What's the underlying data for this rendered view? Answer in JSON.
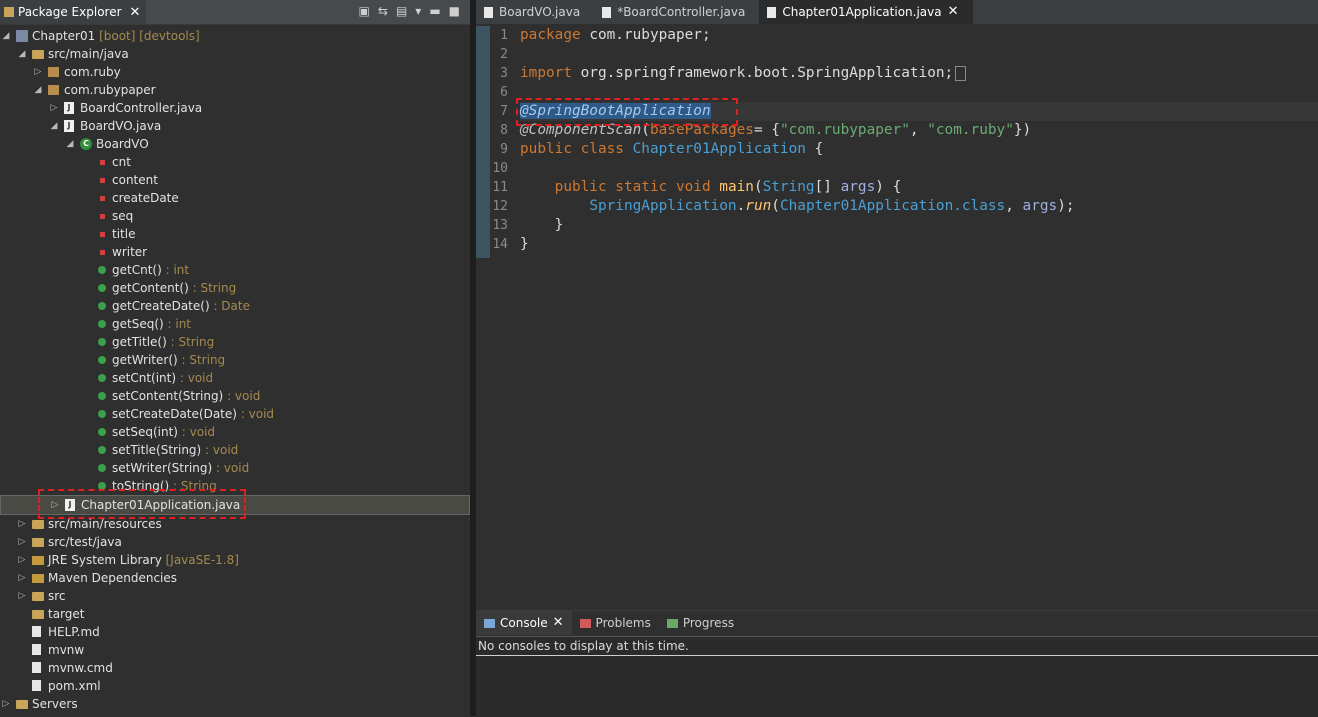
{
  "package_explorer": {
    "title": "Package Explorer",
    "tree": [
      {
        "label": "Chapter01",
        "dec": " [boot] [devtools]",
        "icon": "project-icon",
        "depth": 0,
        "expanded": true
      },
      {
        "label": "src/main/java",
        "dec": "",
        "icon": "folder-icon",
        "depth": 1,
        "expanded": true
      },
      {
        "label": "com.ruby",
        "dec": "",
        "icon": "package-icon",
        "depth": 2,
        "expanded": false
      },
      {
        "label": "com.rubypaper",
        "dec": "",
        "icon": "package-icon",
        "depth": 2,
        "expanded": true
      },
      {
        "label": "BoardController.java",
        "dec": "",
        "icon": "java-file-icon",
        "depth": 3,
        "expanded": false
      },
      {
        "label": "BoardVO.java",
        "dec": "",
        "icon": "java-file-icon",
        "depth": 3,
        "expanded": true
      },
      {
        "label": "BoardVO",
        "dec": "",
        "icon": "class-icon",
        "depth": 4,
        "expanded": true
      },
      {
        "label": "cnt",
        "dec": "",
        "icon": "field-icon",
        "depth": 5
      },
      {
        "label": "content",
        "dec": "",
        "icon": "field-icon",
        "depth": 5
      },
      {
        "label": "createDate",
        "dec": "",
        "icon": "field-icon",
        "depth": 5
      },
      {
        "label": "seq",
        "dec": "",
        "icon": "field-icon",
        "depth": 5
      },
      {
        "label": "title",
        "dec": "",
        "icon": "field-icon",
        "depth": 5
      },
      {
        "label": "writer",
        "dec": "",
        "icon": "field-icon",
        "depth": 5
      },
      {
        "label": "getCnt()",
        "dec": " : int",
        "icon": "method-icon",
        "depth": 5
      },
      {
        "label": "getContent()",
        "dec": " : String",
        "icon": "method-icon",
        "depth": 5
      },
      {
        "label": "getCreateDate()",
        "dec": " : Date",
        "icon": "method-icon",
        "depth": 5
      },
      {
        "label": "getSeq()",
        "dec": " : int",
        "icon": "method-icon",
        "depth": 5
      },
      {
        "label": "getTitle()",
        "dec": " : String",
        "icon": "method-icon",
        "depth": 5
      },
      {
        "label": "getWriter()",
        "dec": " : String",
        "icon": "method-icon",
        "depth": 5
      },
      {
        "label": "setCnt(int)",
        "dec": " : void",
        "icon": "method-icon",
        "depth": 5
      },
      {
        "label": "setContent(String)",
        "dec": " : void",
        "icon": "method-icon",
        "depth": 5
      },
      {
        "label": "setCreateDate(Date)",
        "dec": " : void",
        "icon": "method-icon",
        "depth": 5
      },
      {
        "label": "setSeq(int)",
        "dec": " : void",
        "icon": "method-icon",
        "depth": 5
      },
      {
        "label": "setTitle(String)",
        "dec": " : void",
        "icon": "method-icon",
        "depth": 5
      },
      {
        "label": "setWriter(String)",
        "dec": " : void",
        "icon": "method-icon",
        "depth": 5
      },
      {
        "label": "toString()",
        "dec": " : String",
        "icon": "method-icon",
        "depth": 5
      },
      {
        "label": "Chapter01Application.java",
        "dec": "",
        "icon": "java-file-icon",
        "depth": 3,
        "expanded": false,
        "selected": true
      },
      {
        "label": "src/main/resources",
        "dec": "",
        "icon": "folder-icon",
        "depth": 1,
        "expanded": false
      },
      {
        "label": "src/test/java",
        "dec": "",
        "icon": "folder-icon",
        "depth": 1,
        "expanded": false
      },
      {
        "label": "JRE System Library",
        "dec": " [JavaSE-1.8]",
        "icon": "library-icon",
        "depth": 1,
        "expanded": false
      },
      {
        "label": "Maven Dependencies",
        "dec": "",
        "icon": "library-icon",
        "depth": 1,
        "expanded": false
      },
      {
        "label": "src",
        "dec": "",
        "icon": "folder-icon",
        "depth": 1,
        "expanded": false
      },
      {
        "label": "target",
        "dec": "",
        "icon": "folder-icon",
        "depth": 1
      },
      {
        "label": "HELP.md",
        "dec": "",
        "icon": "file-icon",
        "depth": 1
      },
      {
        "label": "mvnw",
        "dec": "",
        "icon": "file-icon",
        "depth": 1
      },
      {
        "label": "mvnw.cmd",
        "dec": "",
        "icon": "file-icon",
        "depth": 1
      },
      {
        "label": "pom.xml",
        "dec": "",
        "icon": "file-icon",
        "depth": 1
      },
      {
        "label": "Servers",
        "dec": "",
        "icon": "folder-icon",
        "depth": 0,
        "expanded": false
      }
    ]
  },
  "editor": {
    "tabs": [
      {
        "label": "BoardVO.java",
        "active": false
      },
      {
        "label": "*BoardController.java",
        "active": false
      },
      {
        "label": "Chapter01Application.java",
        "active": true
      }
    ],
    "line_numbers": [
      "1",
      "2",
      "3",
      "6",
      "7",
      "8",
      "9",
      "10",
      "11",
      "12",
      "13",
      "14"
    ],
    "code": {
      "l1_kw": "package",
      "l1_rest": " com.rubypaper;",
      "l3_kw": "import",
      "l3_rest": " org.springframework.boot.SpringApplication;",
      "l7_ann": "@SpringBootApplication",
      "l8_ann": "@ComponentScan",
      "l8_open": "(",
      "l8_param": "basePackages",
      "l8_eq": "= {",
      "l8_s1": "\"com.rubypaper\"",
      "l8_comma": ", ",
      "l8_s2": "\"com.ruby\"",
      "l8_close": "})",
      "l9_kw": "public class ",
      "l9_ty": "Chapter01Application",
      "l9_rest": " {",
      "l11_kw": "    public static void ",
      "l11_m": "main",
      "l11_p1": "(",
      "l11_ty": "String",
      "l11_p2": "[] ",
      "l11_arg": "args",
      "l11_rest": ") {",
      "l12_ind": "        ",
      "l12_ty": "SpringApplication",
      "l12_dot": ".",
      "l12_run": "run",
      "l12_p": "(",
      "l12_cls": "Chapter01Application",
      "l12_kw": ".class",
      "l12_c": ", ",
      "l12_arg": "args",
      "l12_end": ");",
      "l13": "    }",
      "l14": "}"
    }
  },
  "console": {
    "tabs": [
      {
        "label": "Console",
        "active": true
      },
      {
        "label": "Problems",
        "active": false
      },
      {
        "label": "Progress",
        "active": false
      }
    ],
    "message": "No consoles to display at this time."
  },
  "colors": {
    "highlight": "#e02020",
    "keyword": "#cc7832",
    "string": "#6aab73",
    "type": "#4a9fd4"
  }
}
